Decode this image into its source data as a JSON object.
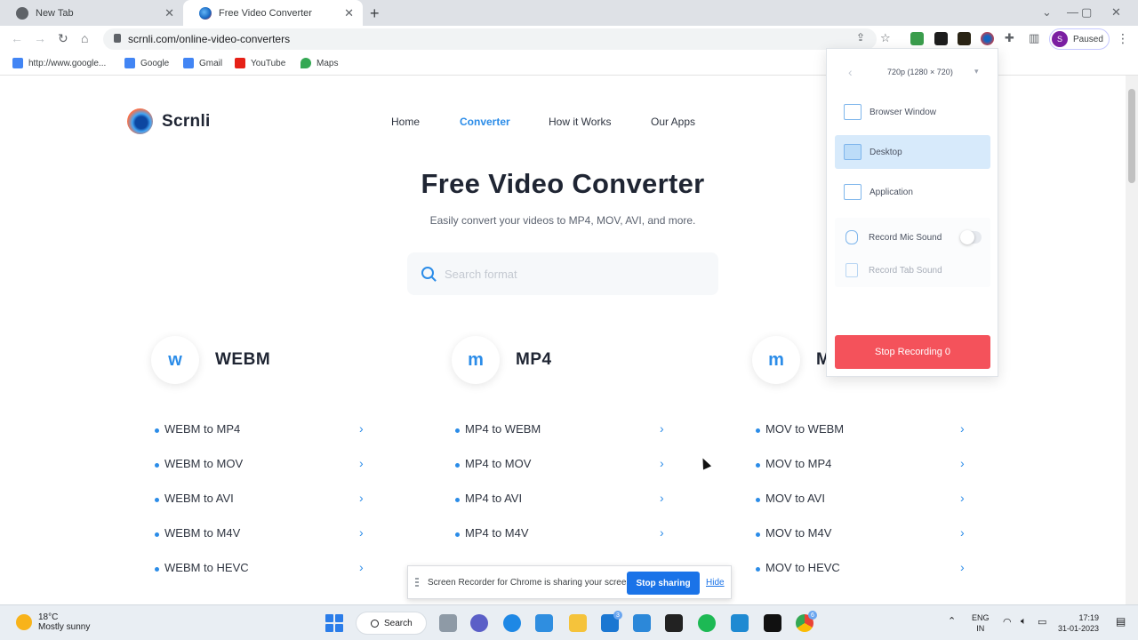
{
  "browser": {
    "tabs": [
      {
        "title": "New Tab",
        "active": false
      },
      {
        "title": "Free Video Converter",
        "active": true
      }
    ],
    "new_tab_icon": "+",
    "url": "scrnli.com/online-video-converters",
    "profile": {
      "initial": "S",
      "status": "Paused"
    },
    "bookmarks": [
      "http://www.google...",
      "Google",
      "Gmail",
      "YouTube",
      "Maps"
    ]
  },
  "page": {
    "logo_text": "Scrnli",
    "nav": [
      {
        "label": "Home",
        "active": false
      },
      {
        "label": "Converter",
        "active": true
      },
      {
        "label": "How it Works",
        "active": false
      },
      {
        "label": "Our Apps",
        "active": false
      }
    ],
    "hero_title": "Free Video Converter",
    "hero_subtitle": "Easily convert your videos to MP4, MOV, AVI, and more.",
    "search_placeholder": "Search format",
    "columns": [
      {
        "badge": "w",
        "title": "WEBM",
        "items": [
          "WEBM to MP4",
          "WEBM to MOV",
          "WEBM to AVI",
          "WEBM to M4V",
          "WEBM to HEVC"
        ]
      },
      {
        "badge": "m",
        "title": "MP4",
        "items": [
          "MP4 to WEBM",
          "MP4 to MOV",
          "MP4 to AVI",
          "MP4 to M4V"
        ]
      },
      {
        "badge": "m",
        "title": "MOV",
        "items": [
          "MOV to WEBM",
          "MOV to MP4",
          "MOV to AVI",
          "MOV to M4V",
          "MOV to HEVC"
        ]
      }
    ]
  },
  "recorder_popup": {
    "resolution": "720p (1280 × 720)",
    "sources": [
      {
        "label": "Browser Window",
        "selected": false
      },
      {
        "label": "Desktop",
        "selected": true
      },
      {
        "label": "Application",
        "selected": false
      }
    ],
    "audio": [
      {
        "label": "Record Mic Sound",
        "enabled": false
      },
      {
        "label": "Record Tab Sound",
        "enabled": false
      }
    ],
    "stop_label": "Stop Recording 0"
  },
  "share_bar": {
    "message": "Screen Recorder for Chrome is sharing your screen.",
    "stop_label": "Stop sharing",
    "hide_label": "Hide"
  },
  "taskbar": {
    "weather_temp": "18°C",
    "weather_desc": "Mostly sunny",
    "search_label": "Search",
    "mail_badge": "3",
    "chrome_badge": "6",
    "lang": "ENG",
    "region": "IN",
    "time": "17:19",
    "date": "31-01-2023"
  },
  "colors": {
    "accent": "#2b8ce8",
    "stop_red": "#f4525b",
    "share_blue": "#1a73e8"
  }
}
